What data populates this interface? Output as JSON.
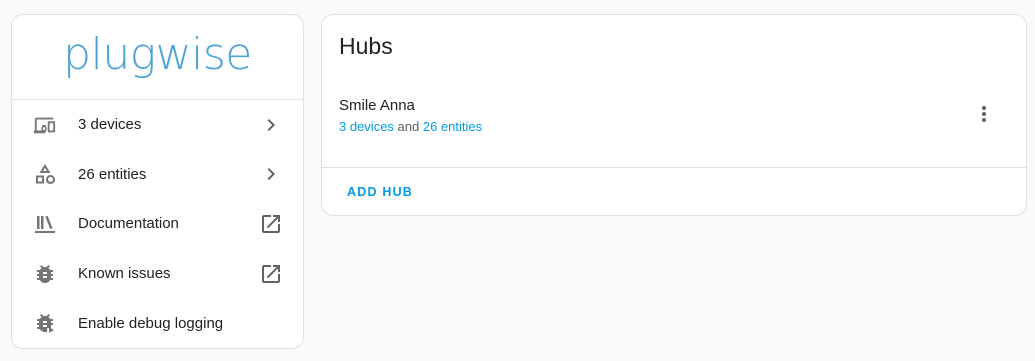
{
  "colors": {
    "accent": "#039be5",
    "logo": "#4ba3d6"
  },
  "info": {
    "logo_text": "plugwise",
    "items": [
      {
        "icon": "devices-icon",
        "label": "3 devices",
        "trail_icon": "chevron-right-icon"
      },
      {
        "icon": "shapes-icon",
        "label": "26 entities",
        "trail_icon": "chevron-right-icon"
      },
      {
        "icon": "library-books-icon",
        "label": "Documentation",
        "trail_icon": "open-in-new-icon"
      },
      {
        "icon": "bug-icon",
        "label": "Known issues",
        "trail_icon": "open-in-new-icon"
      },
      {
        "icon": "bug-play-icon",
        "label": "Enable debug logging",
        "trail_icon": ""
      }
    ]
  },
  "hubs": {
    "title": "Hubs",
    "entries": [
      {
        "name": "Smile Anna",
        "devices_link": "3 devices",
        "joiner": " and ",
        "entities_link": "26 entities",
        "menu_icon": "dots-vertical-icon"
      }
    ],
    "add_label": "ADD HUB"
  }
}
